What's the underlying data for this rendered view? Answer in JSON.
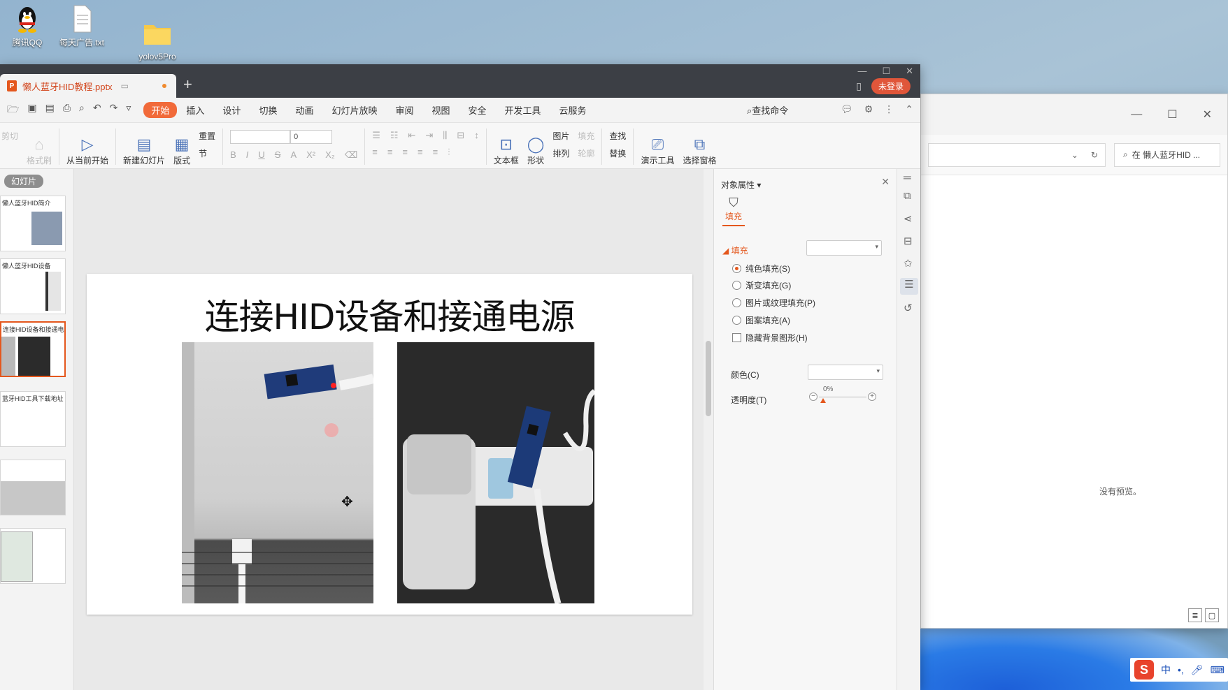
{
  "desktop": {
    "icons": [
      {
        "label": "腾讯QQ"
      },
      {
        "label": "每天广告.txt"
      },
      {
        "label": "yolov5Pro"
      }
    ]
  },
  "explorer": {
    "search_placeholder": "在 懒人蓝牙HID ...",
    "no_preview": "没有预览。"
  },
  "tray": {
    "lang": "中"
  },
  "wps": {
    "doc_tab": "懒人蓝牙HID教程.pptx",
    "new_tab": "+",
    "login": "未登录",
    "menu": [
      "开始",
      "插入",
      "设计",
      "切换",
      "动画",
      "幻灯片放映",
      "审阅",
      "视图",
      "安全",
      "开发工具",
      "云服务"
    ],
    "active_menu": "开始",
    "find_command": "查找命令",
    "ribbon": {
      "cut": "剪切",
      "format_painter": "格式刷",
      "from_current": "从当前开始",
      "new_slide": "新建幻灯片",
      "layout": "版式",
      "reset": "重置",
      "section": "节",
      "font_size": "0",
      "textbox": "文本框",
      "shape": "形状",
      "picture": "图片",
      "fill": "填充",
      "arrange": "排列",
      "outline": "轮廓",
      "find": "查找",
      "replace": "替换",
      "presenter": "演示工具",
      "selection_pane": "选择窗格"
    },
    "slides_label": "幻灯片",
    "thumbnails": [
      {
        "title": "懒人蓝牙HID简介"
      },
      {
        "title": "懒人蓝牙HID设备"
      },
      {
        "title": "连接HID设备和接通电源"
      },
      {
        "title": "蓝牙HID工具下载地址"
      },
      {
        "title": ""
      },
      {
        "title": ""
      }
    ],
    "slide": {
      "title": "连接HID设备和接通电源"
    },
    "props": {
      "header": "对象属性",
      "tab": "填充",
      "section": "填充",
      "options": [
        {
          "label": "纯色填充(S)",
          "selected": true
        },
        {
          "label": "渐变填充(G)",
          "selected": false
        },
        {
          "label": "图片或纹理填充(P)",
          "selected": false
        },
        {
          "label": "图案填充(A)",
          "selected": false
        }
      ],
      "hide_bg": "隐藏背景图形(H)",
      "color_label": "颜色(C)",
      "transparency_label": "透明度(T)",
      "transparency_value": "0%"
    }
  }
}
